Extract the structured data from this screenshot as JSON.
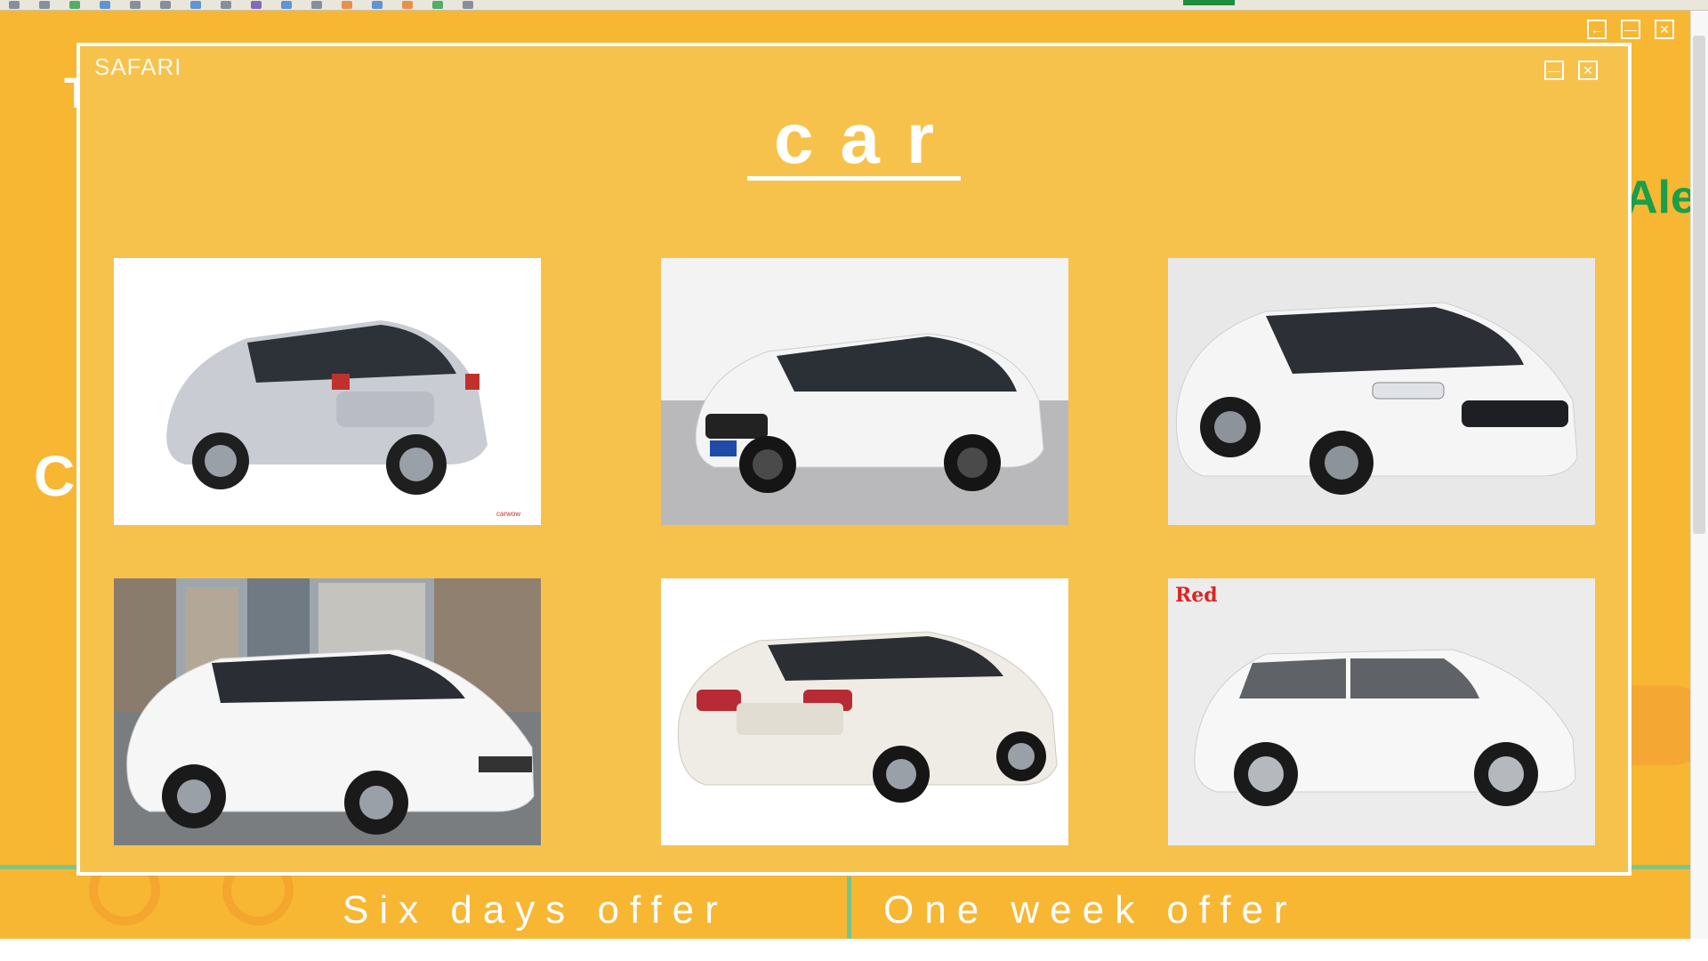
{
  "modal": {
    "brand": "SAFARI",
    "title": "car",
    "images": [
      {
        "alt": "silver hatchback rear view"
      },
      {
        "alt": "white hatchback in showroom"
      },
      {
        "alt": "white hatchback front view"
      },
      {
        "alt": "white hatchback city backdrop"
      },
      {
        "alt": "white sedan rear view"
      },
      {
        "alt": "white hatchback side view"
      }
    ],
    "logo_text": "Red"
  },
  "background": {
    "partial_letter_top": "T",
    "partial_letter_left": "C",
    "partial_name_right": "Ale",
    "offers": [
      "Six days offer",
      "One week offer"
    ]
  },
  "colors": {
    "page_bg": "#f7b733",
    "modal_bg": "#f7c24b",
    "accent_green": "#1b9e4a"
  }
}
